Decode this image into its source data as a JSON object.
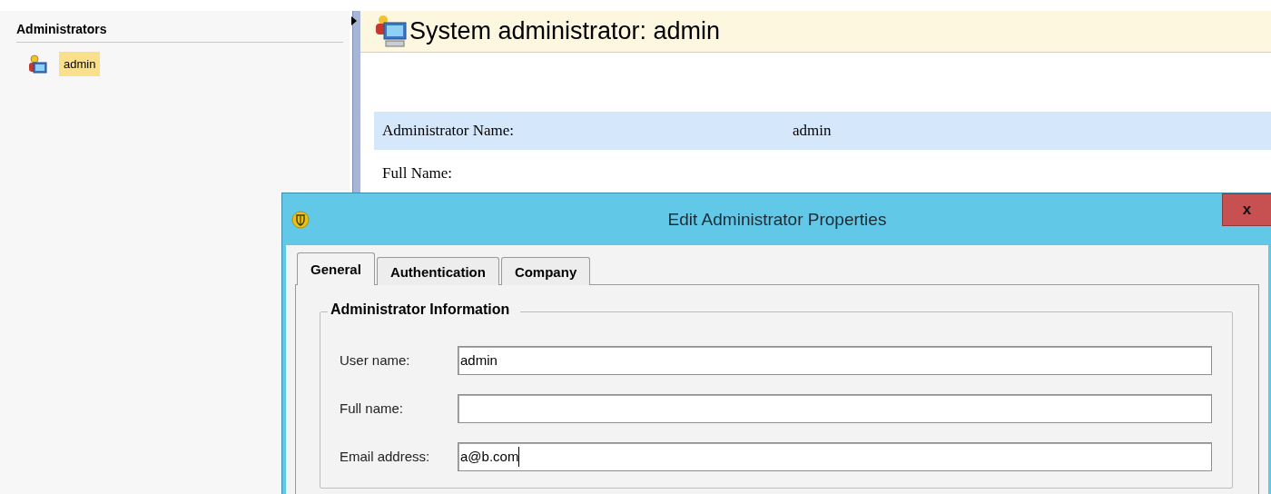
{
  "sidebar": {
    "title": "Administrators",
    "items": [
      {
        "label": "admin",
        "selected": true
      }
    ]
  },
  "header": {
    "title": "System administrator: admin"
  },
  "details": [
    {
      "label": "Administrator Name:",
      "value": "admin",
      "highlighted": true
    },
    {
      "label": "Full Name:",
      "highlighted": false
    }
  ],
  "dialog": {
    "title": "Edit Administrator Properties",
    "close": "x",
    "tabs": [
      {
        "label": "General",
        "selected": true
      },
      {
        "label": "Authentication",
        "selected": false
      },
      {
        "label": "Company",
        "selected": false
      }
    ],
    "group": {
      "title": "Administrator Information",
      "fields": [
        {
          "label": "User name:",
          "value": "admin"
        },
        {
          "label": "Full name:"
        },
        {
          "label": "Email address:",
          "value": "a@b.com",
          "focused": true
        }
      ]
    }
  }
}
